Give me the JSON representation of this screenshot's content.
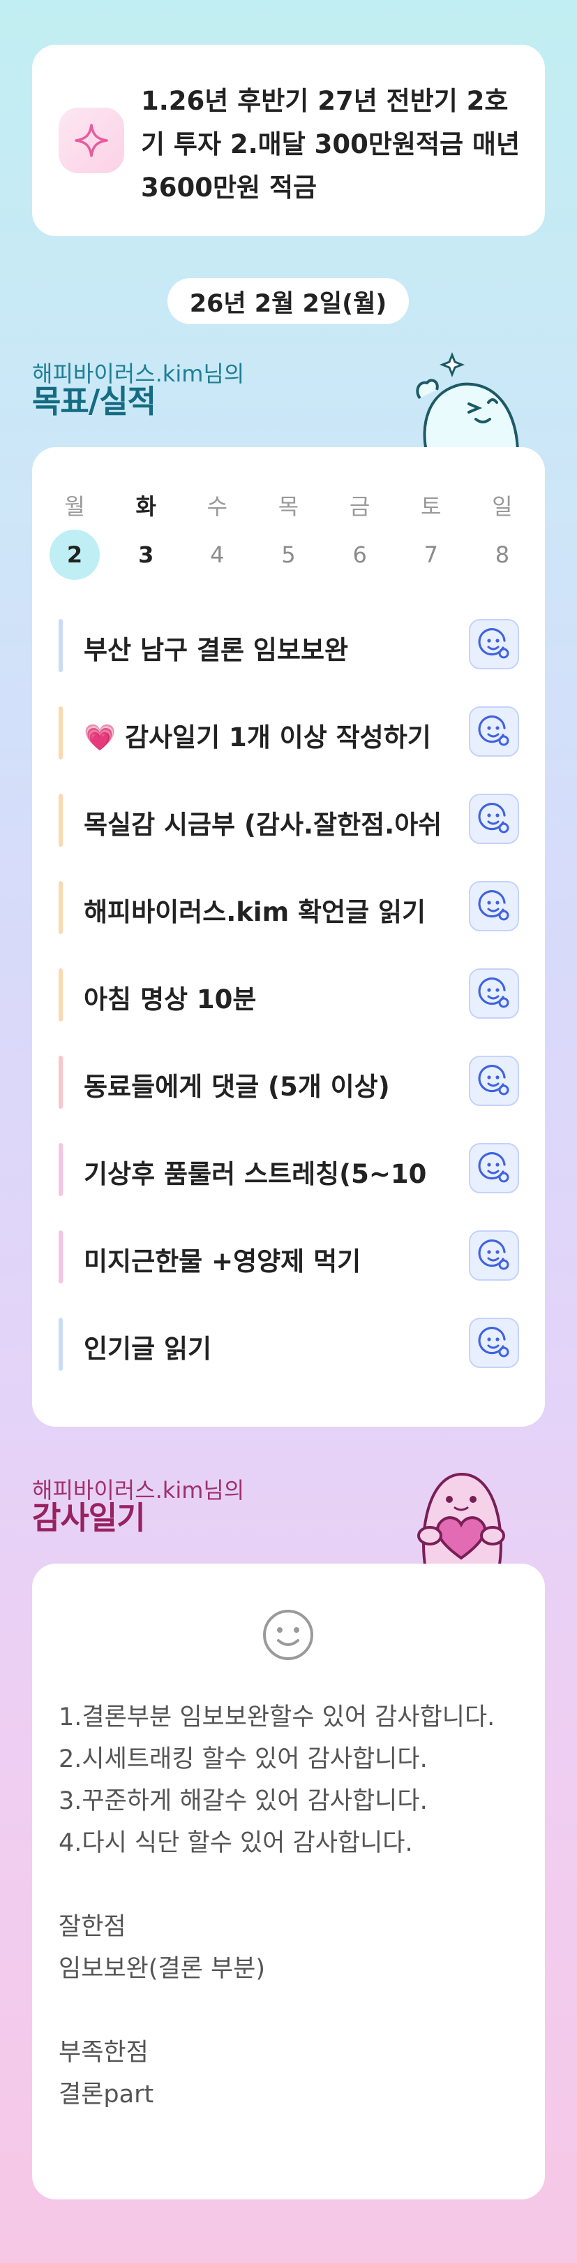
{
  "goal": {
    "icon": "sparkle-icon",
    "text": "1.26년 후반기 27년 전반기 2호기 투자 2.매달 300만원적금 매년 3600만원 적금"
  },
  "date_label": "26년 2월 2일(월)",
  "goals_section": {
    "subtitle": "해피바이러스.kim님의",
    "title": "목표/실적",
    "mascot_icon": "sparkle-character-icon"
  },
  "week": {
    "days": [
      "월",
      "화",
      "수",
      "목",
      "금",
      "토",
      "일"
    ],
    "dates": [
      "2",
      "3",
      "4",
      "5",
      "6",
      "7",
      "8"
    ],
    "selected_index": 0
  },
  "tasks": [
    {
      "label": "부산 남구 결론 임보보완",
      "color": "#c9dcf5"
    },
    {
      "label": "💗 감사일기 1개 이상 작성하기",
      "color": "#fbd9b0"
    },
    {
      "label": "목실감 시금부 (감사.잘한점.아쉬",
      "color": "#fbd9b0"
    },
    {
      "label": "해피바이러스.kim 확언글 읽기",
      "color": "#fbd9b0"
    },
    {
      "label": "아침 명상 10분",
      "color": "#fbd9b0"
    },
    {
      "label": "동료들에게 댓글 (5개 이상)",
      "color": "#f9c6cc"
    },
    {
      "label": "기상후 품룰러 스트레칭(5~10",
      "color": "#f6c5e3"
    },
    {
      "label": "미지근한물 +영양제 먹기",
      "color": "#f6c5e3"
    },
    {
      "label": "인기글 읽기",
      "color": "#c9dcf5"
    }
  ],
  "task_button_icon": "smile-check-icon",
  "gratitude_section": {
    "subtitle": "해피바이러스.kim님의",
    "title": "감사일기",
    "mascot_icon": "heart-character-icon"
  },
  "gratitude": {
    "icon": "smile-face-icon",
    "text": "1.결론부분 임보보완할수 있어 감사합니다.\n2.시세트래킹 할수 있어 감사합니다.\n3.꾸준하게 해갈수 있어 감사합니다.\n4.다시 식단 할수 있어 감사합니다.\n\n잘한점\n임보보완(결론 부분)\n\n부족한점\n결론part"
  }
}
